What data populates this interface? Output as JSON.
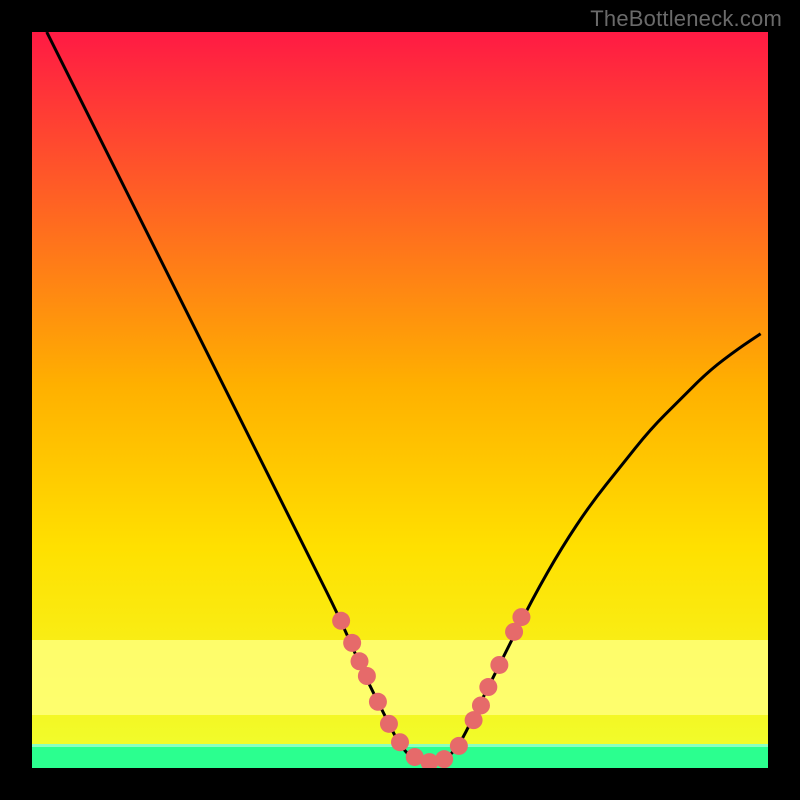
{
  "watermark": "TheBottleneck.com",
  "chart_data": {
    "type": "line",
    "title": "",
    "xlabel": "",
    "ylabel": "",
    "xlim": [
      0,
      100
    ],
    "ylim": [
      0,
      100
    ],
    "series": [
      {
        "name": "curve",
        "x": [
          2,
          6,
          10,
          14,
          18,
          22,
          26,
          30,
          34,
          38,
          42,
          45,
          48,
          50,
          52,
          54,
          56,
          58,
          60,
          64,
          68,
          72,
          76,
          80,
          84,
          88,
          92,
          96,
          99
        ],
        "y": [
          100,
          92,
          84,
          76,
          68,
          60,
          52,
          44,
          36,
          28,
          20,
          13,
          7,
          3,
          1,
          0.5,
          1,
          3,
          7,
          15,
          23,
          30,
          36,
          41,
          46,
          50,
          54,
          57,
          59
        ]
      }
    ],
    "markers": {
      "name": "highlight-dots",
      "x": [
        42.0,
        43.5,
        44.5,
        45.5,
        47.0,
        48.5,
        50.0,
        52.0,
        54.0,
        56.0,
        58.0,
        60.0,
        61.0,
        62.0,
        63.5,
        65.5,
        66.5
      ],
      "y": [
        20.0,
        17.0,
        14.5,
        12.5,
        9.0,
        6.0,
        3.5,
        1.5,
        0.8,
        1.2,
        3.0,
        6.5,
        8.5,
        11.0,
        14.0,
        18.5,
        20.5
      ]
    },
    "background": {
      "top_color": "#ff1a44",
      "mid_color": "#ffd000",
      "band_color": "#ffff7a",
      "bottom_color": "#2bff8f"
    }
  }
}
